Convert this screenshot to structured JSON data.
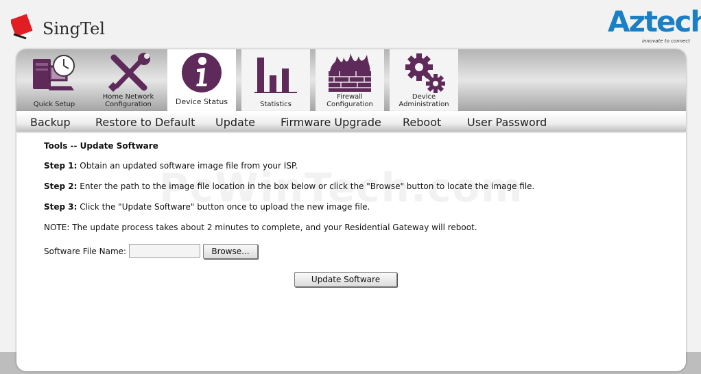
{
  "header": {
    "left_brand": "SingTel",
    "right_brand": "Aztech",
    "right_tagline": "innovate to connect"
  },
  "tabs": [
    {
      "id": "quick-setup",
      "label": "Quick Setup",
      "icon": "computer-clock-icon",
      "active": false
    },
    {
      "id": "home-network",
      "label": "Home Network Configuration",
      "icon": "wrench-screwdriver-icon",
      "active": false
    },
    {
      "id": "device-status",
      "label": "Device Status",
      "icon": "info-icon",
      "active": true
    },
    {
      "id": "statistics",
      "label": "Statistics",
      "icon": "bar-chart-icon",
      "active": false
    },
    {
      "id": "firewall",
      "label": "Firewall Configuration",
      "icon": "firewall-icon",
      "active": false
    },
    {
      "id": "device-admin",
      "label": "Device Administration",
      "icon": "gears-icon",
      "active": false
    }
  ],
  "subnav": [
    "Backup",
    "Restore to Default",
    "Update",
    "Firmware Upgrade",
    "Reboot",
    "User Password"
  ],
  "content": {
    "title": "Tools -- Update Software",
    "step1_label": "Step 1:",
    "step1_text": " Obtain an updated software image file from your ISP.",
    "step2_label": "Step 2:",
    "step2_text": " Enter the path to the image file location in the box below or click the \"Browse\" button to locate the image file.",
    "step3_label": "Step 3:",
    "step3_text": " Click the \"Update Software\" button once to upload the new image file.",
    "note": "NOTE: The update process takes about 2 minutes to complete, and your Residential Gateway will reboot.",
    "file_label": "Software File Name:",
    "file_value": "",
    "browse_label": "Browse...",
    "update_label": "Update Software"
  },
  "watermark": "PcWinTech.com",
  "colors": {
    "tab_icon_purple": "#5e2a5a",
    "aztech_blue": "#1a7fc4",
    "singtel_red": "#e01e24"
  }
}
